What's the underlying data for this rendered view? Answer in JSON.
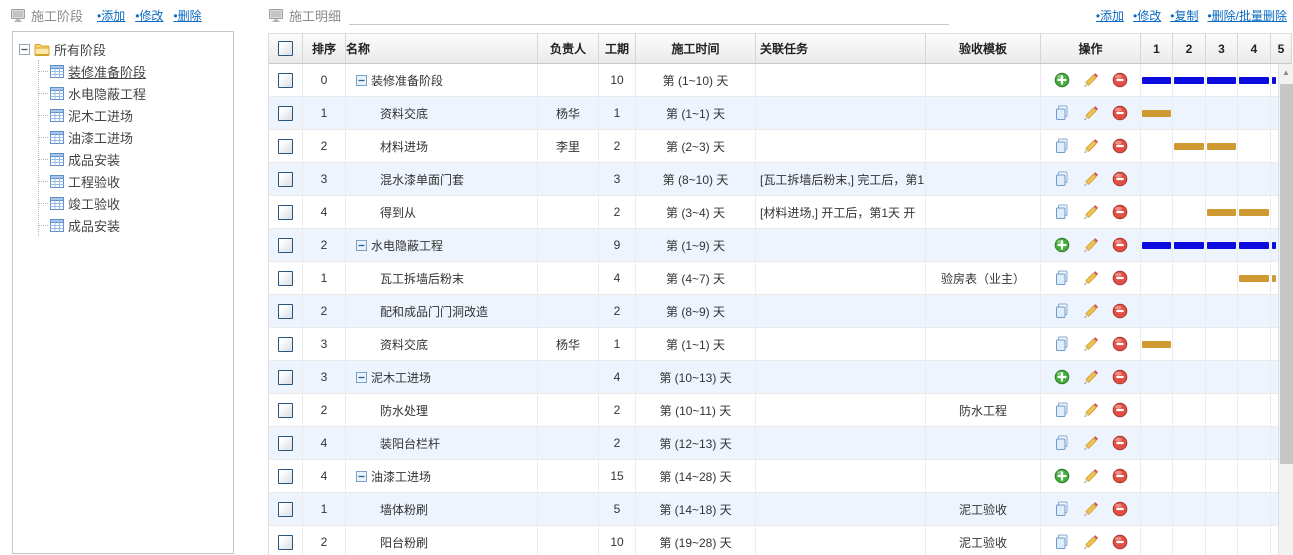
{
  "colors": {
    "link": "#0a6bc2",
    "bar_blue": "#0b0bdf",
    "bar_orange": "#cf9a32",
    "row_alt": "#eef4fd"
  },
  "left_panel": {
    "title": "施工阶段",
    "actions": [
      {
        "label": "•添加"
      },
      {
        "label": "•修改"
      },
      {
        "label": "•删除"
      }
    ],
    "tree": {
      "root_label": "所有阶段",
      "items": [
        {
          "label": "装修准备阶段",
          "selected": true
        },
        {
          "label": "水电隐蔽工程",
          "selected": false
        },
        {
          "label": "泥木工进场",
          "selected": false
        },
        {
          "label": "油漆工进场",
          "selected": false
        },
        {
          "label": "成品安装",
          "selected": false
        },
        {
          "label": "工程验收",
          "selected": false
        },
        {
          "label": "竣工验收",
          "selected": false
        },
        {
          "label": "成品安装",
          "selected": false
        }
      ]
    }
  },
  "right_panel": {
    "title": "施工明细",
    "actions": [
      {
        "label": "•添加"
      },
      {
        "label": "•修改"
      },
      {
        "label": "•复制"
      },
      {
        "label": "•删除/批量删除"
      }
    ]
  },
  "table": {
    "headers": {
      "sort": "排序",
      "name": "名称",
      "leader": "负责人",
      "duration": "工期",
      "time": "施工时间",
      "task": "关联任务",
      "template": "验收模板",
      "ops": "操作",
      "days": [
        "1",
        "2",
        "3",
        "4",
        "5"
      ]
    },
    "rows": [
      {
        "sort": "0",
        "group": true,
        "name": "装修准备阶段",
        "leader": "",
        "duration": "10",
        "time": "第 (1~10) 天",
        "task": "",
        "template": "",
        "bar": {
          "from": 1,
          "to": 5,
          "color": "blue"
        }
      },
      {
        "sort": "1",
        "group": false,
        "name": "资料交底",
        "leader": "杨华",
        "duration": "1",
        "time": "第 (1~1) 天",
        "task": "",
        "template": "",
        "bar": {
          "from": 1,
          "to": 1,
          "color": "orange"
        }
      },
      {
        "sort": "2",
        "group": false,
        "name": "材料进场",
        "leader": "李里",
        "duration": "2",
        "time": "第 (2~3) 天",
        "task": "",
        "template": "",
        "bar": {
          "from": 2,
          "to": 3,
          "color": "orange"
        }
      },
      {
        "sort": "3",
        "group": false,
        "name": "混水漆单面门套",
        "leader": "",
        "duration": "3",
        "time": "第 (8~10) 天",
        "task": "[瓦工拆墙后粉末,] 完工后，第1",
        "template": "",
        "bar": null
      },
      {
        "sort": "4",
        "group": false,
        "name": "得到从",
        "leader": "",
        "duration": "2",
        "time": "第 (3~4) 天",
        "task": "[材料进场,] 开工后，第1天 开",
        "template": "",
        "bar": {
          "from": 3,
          "to": 4,
          "color": "orange"
        }
      },
      {
        "sort": "2",
        "group": true,
        "name": "水电隐蔽工程",
        "leader": "",
        "duration": "9",
        "time": "第 (1~9) 天",
        "task": "",
        "template": "",
        "bar": {
          "from": 1,
          "to": 5,
          "color": "blue"
        }
      },
      {
        "sort": "1",
        "group": false,
        "name": "瓦工拆墙后粉末",
        "leader": "",
        "duration": "4",
        "time": "第 (4~7) 天",
        "task": "",
        "template": "验房表（业主）",
        "bar": {
          "from": 4,
          "to": 5,
          "color": "orange"
        }
      },
      {
        "sort": "2",
        "group": false,
        "name": "配和成品门门洞改造",
        "leader": "",
        "duration": "2",
        "time": "第 (8~9) 天",
        "task": "",
        "template": "",
        "bar": null
      },
      {
        "sort": "3",
        "group": false,
        "name": "资料交底",
        "leader": "杨华",
        "duration": "1",
        "time": "第 (1~1) 天",
        "task": "",
        "template": "",
        "bar": {
          "from": 1,
          "to": 1,
          "color": "orange"
        }
      },
      {
        "sort": "3",
        "group": true,
        "name": "泥木工进场",
        "leader": "",
        "duration": "4",
        "time": "第 (10~13) 天",
        "task": "",
        "template": "",
        "bar": null
      },
      {
        "sort": "2",
        "group": false,
        "name": "防水处理",
        "leader": "",
        "duration": "2",
        "time": "第 (10~11) 天",
        "task": "",
        "template": "防水工程",
        "bar": null
      },
      {
        "sort": "4",
        "group": false,
        "name": "装阳台栏杆",
        "leader": "",
        "duration": "2",
        "time": "第 (12~13) 天",
        "task": "",
        "template": "",
        "bar": null
      },
      {
        "sort": "4",
        "group": true,
        "name": "油漆工进场",
        "leader": "",
        "duration": "15",
        "time": "第 (14~28) 天",
        "task": "",
        "template": "",
        "bar": null
      },
      {
        "sort": "1",
        "group": false,
        "name": "墙体粉刷",
        "leader": "",
        "duration": "5",
        "time": "第 (14~18) 天",
        "task": "",
        "template": "泥工验收",
        "bar": null
      },
      {
        "sort": "2",
        "group": false,
        "name": "阳台粉刷",
        "leader": "",
        "duration": "10",
        "time": "第 (19~28) 天",
        "task": "",
        "template": "泥工验收",
        "bar": null
      }
    ]
  },
  "scrollbar": {
    "up_arrow": "▲"
  }
}
